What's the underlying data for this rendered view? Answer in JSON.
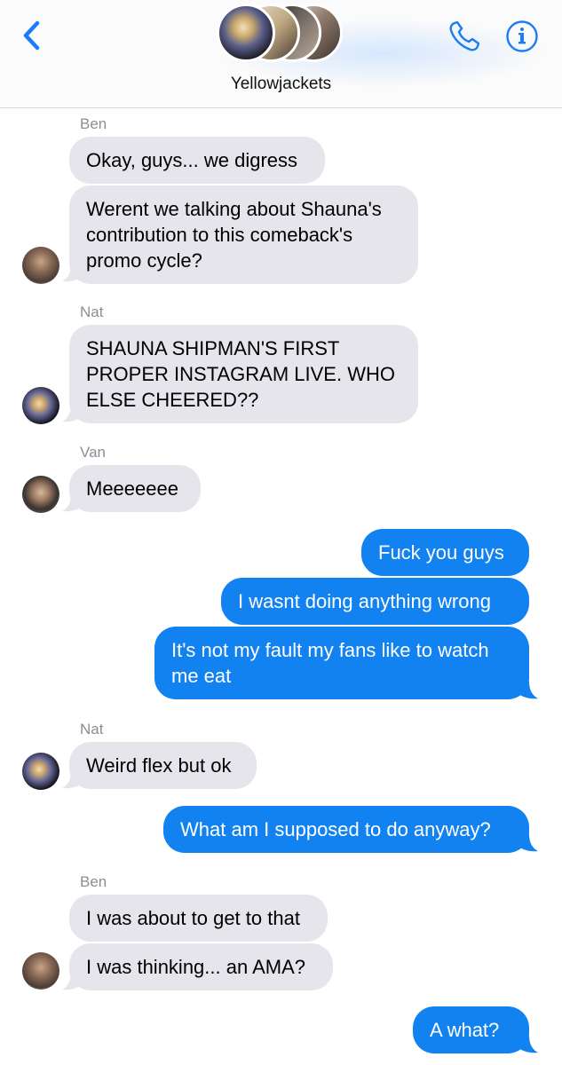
{
  "header": {
    "title": "Yellowjackets",
    "back_icon": "chevron-left-icon",
    "call_icon": "phone-icon",
    "info_icon": "info-icon",
    "accent": "#1b7cf4"
  },
  "messages": [
    {
      "sender": "Ben",
      "direction": "in",
      "text": "Okay, guys... we digress"
    },
    {
      "sender": "Ben",
      "direction": "in",
      "text": "Werent we talking about Shauna's contribution to this comeback's promo cycle?"
    },
    {
      "sender": "Nat",
      "direction": "in",
      "text": "SHAUNA SHIPMAN'S FIRST PROPER INSTAGRAM LIVE. WHO ELSE CHEERED??"
    },
    {
      "sender": "Van",
      "direction": "in",
      "text": "Meeeeeee"
    },
    {
      "sender": "",
      "direction": "out",
      "text": "Fuck you guys"
    },
    {
      "sender": "",
      "direction": "out",
      "text": "I wasnt doing anything wrong"
    },
    {
      "sender": "",
      "direction": "out",
      "text": "It's not my fault my fans like to watch me eat"
    },
    {
      "sender": "Nat",
      "direction": "in",
      "text": "Weird flex but ok"
    },
    {
      "sender": "",
      "direction": "out",
      "text": "What am I supposed to do anyway?"
    },
    {
      "sender": "Ben",
      "direction": "in",
      "text": "I was about to get to that"
    },
    {
      "sender": "Ben",
      "direction": "in",
      "text": "I was thinking... an AMA?"
    },
    {
      "sender": "",
      "direction": "out",
      "text": "A what?"
    }
  ],
  "colors": {
    "incoming_bubble": "#e6e5eb",
    "outgoing_bubble": "#1182f0",
    "sender_label": "#8e8e93"
  }
}
